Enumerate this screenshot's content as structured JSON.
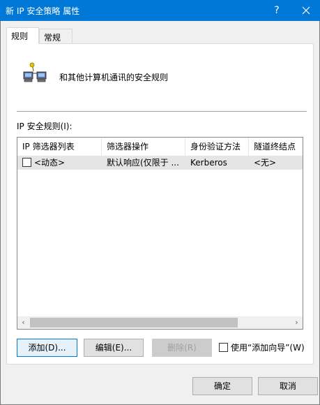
{
  "window": {
    "title": "新 IP 安全策略 属性",
    "help_label": "?"
  },
  "tabs": [
    {
      "label": "规则",
      "active": true
    },
    {
      "label": "常规",
      "active": false
    }
  ],
  "panel": {
    "description": "和其他计算机通讯的安全规则",
    "rules_label": "IP 安全规则(I):"
  },
  "table": {
    "columns": [
      "IP 筛选器列表",
      "筛选器操作",
      "身份验证方法",
      "隧道终结点"
    ],
    "rows": [
      {
        "checked": false,
        "cells": [
          "<动态>",
          "默认响应(仅限于 ...",
          "Kerberos",
          "<无>"
        ]
      }
    ]
  },
  "scrollbar": {
    "left_arrow": "‹",
    "right_arrow": "›"
  },
  "buttons": {
    "add": "添加(D)...",
    "edit": "编辑(E)...",
    "remove": "删除(R)",
    "wizard_label": "使用“添加向导”(W)",
    "wizard_checked": false,
    "ok": "确定",
    "cancel": "取消"
  },
  "colors": {
    "titlebar": "#0078d7",
    "selected_row": "#e5e5e5"
  }
}
